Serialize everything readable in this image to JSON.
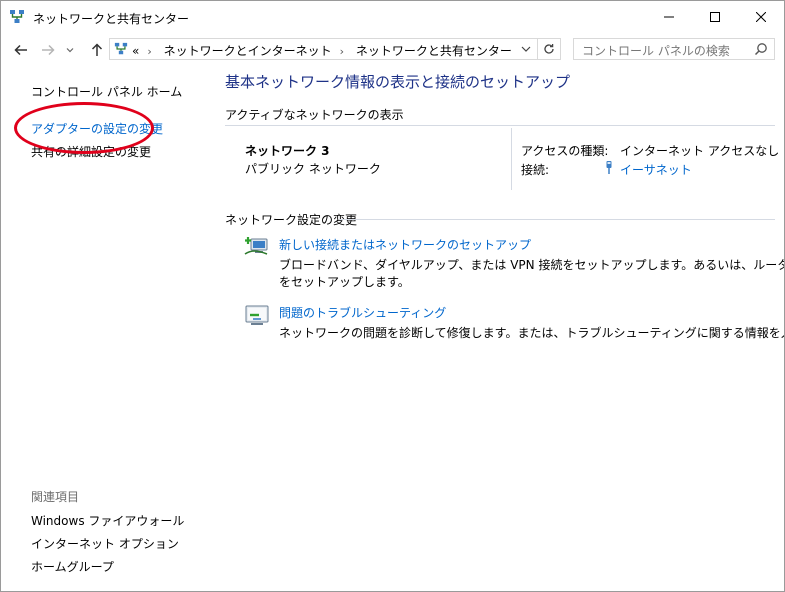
{
  "window": {
    "title": "ネットワークと共有センター"
  },
  "address_bar": {
    "overflow": "«",
    "crumbs": [
      "ネットワークとインターネット",
      "ネットワークと共有センター"
    ]
  },
  "search": {
    "placeholder": "コントロール パネルの検索"
  },
  "left_pane": {
    "home": "コントロール パネル ホーム",
    "links": [
      "アダプターの設定の変更",
      "共有の詳細設定の変更"
    ],
    "related_header": "関連項目",
    "related": [
      "Windows ファイアウォール",
      "インターネット オプション",
      "ホームグループ"
    ]
  },
  "main": {
    "heading": "基本ネットワーク情報の表示と接続のセットアップ",
    "active_section": "アクティブなネットワークの表示",
    "network_name": "ネットワーク 3",
    "network_type": "パブリック ネットワーク",
    "access_type_label": "アクセスの種類:",
    "access_type_value": "インターネット アクセスなし",
    "connection_label": "接続:",
    "connection_value": "イーサネット",
    "change_section": "ネットワーク設定の変更",
    "tasks": [
      {
        "title": "新しい接続またはネットワークのセットアップ",
        "desc1": "ブロードバンド、ダイヤルアップ、または VPN 接続をセットアップします。あるいは、ルーターまたはアクセス ポイント",
        "desc2": "をセットアップします。"
      },
      {
        "title": "問題のトラブルシューティング",
        "desc1": "ネットワークの問題を診断して修復します。または、トラブルシューティングに関する情報を入手します。"
      }
    ]
  },
  "colors": {
    "link": "#0066cc",
    "heading": "#1e3287",
    "highlight": "#e0001b"
  }
}
